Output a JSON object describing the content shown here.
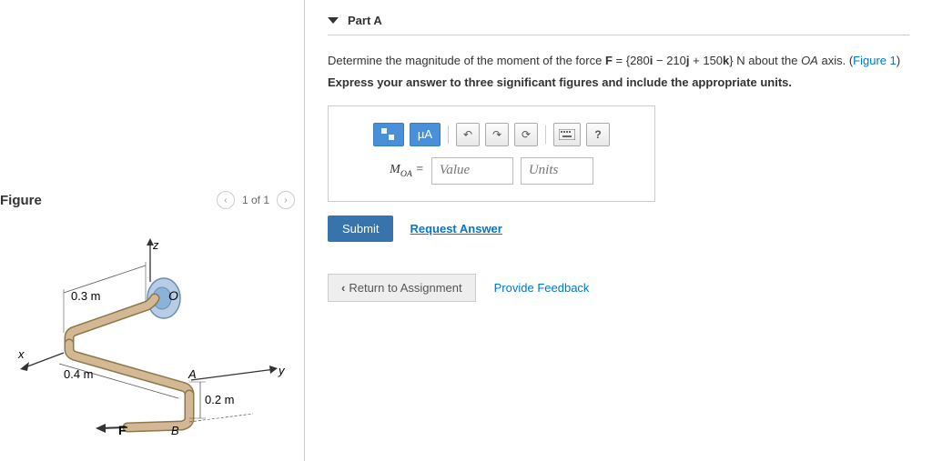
{
  "figure": {
    "title": "Figure",
    "nav": "1 of 1",
    "labels": {
      "z": "z",
      "x": "x",
      "y": "y",
      "o": "O",
      "a": "A",
      "b": "B",
      "f": "F",
      "d1": "0.3 m",
      "d2": "0.4 m",
      "d3": "0.2 m"
    }
  },
  "part": {
    "title": "Part A",
    "problem_prefix": "Determine the magnitude of the moment of the force ",
    "f_label": "F",
    "f_eq": " = {280",
    "i": "i",
    "minus": "  −  210",
    "j": "j",
    "plus": "  +  150",
    "k": "k",
    "suffix": "} N about the ",
    "oa_label": "OA",
    "axis": " axis. (",
    "fig_link": "Figure 1",
    "close": ")",
    "instruction": "Express your answer to three significant figures and include the appropriate units."
  },
  "answer": {
    "moa": "M",
    "oa_sub": "OA",
    "eq": " = ",
    "value_ph": "Value",
    "units_ph": "Units",
    "submit": "Submit",
    "request": "Request Answer",
    "mu": "µA",
    "help": "?"
  },
  "bottom": {
    "return": "Return to Assignment",
    "feedback": "Provide Feedback"
  }
}
